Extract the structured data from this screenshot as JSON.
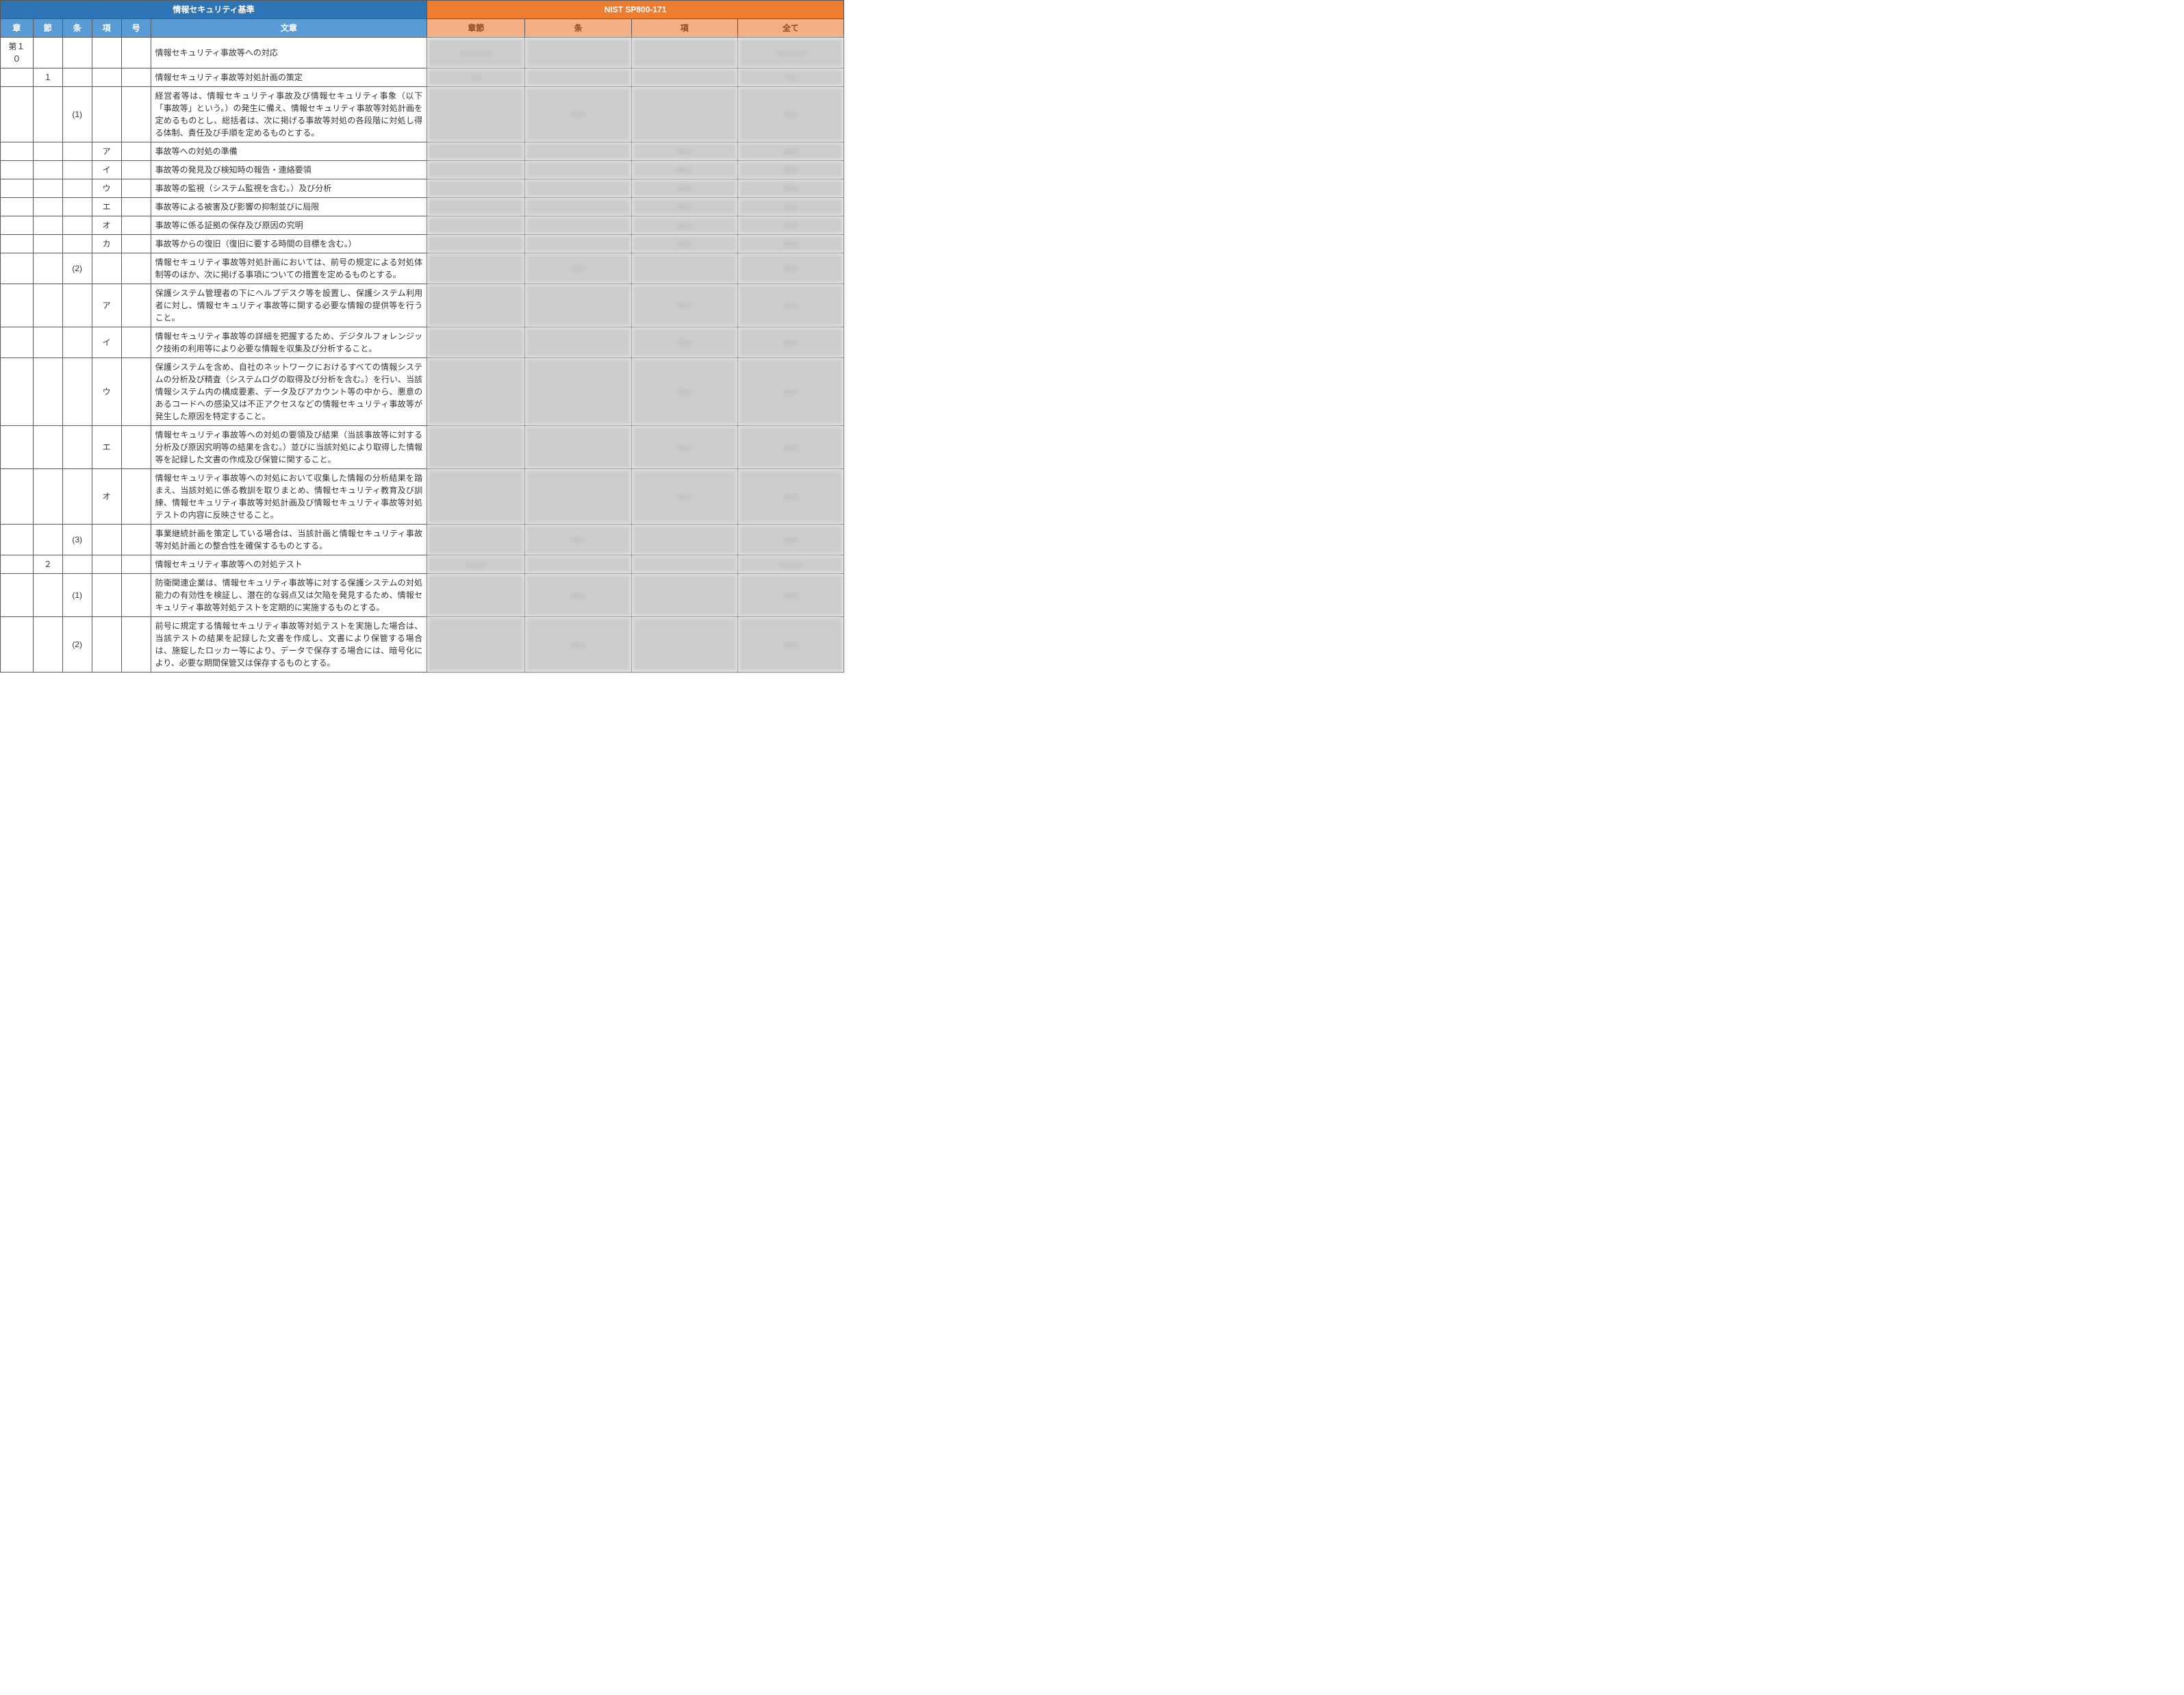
{
  "headers": {
    "left_super": "情報セキュリティ基準",
    "right_super": "NIST SP800-171",
    "left_cols": {
      "sho": "章",
      "setsu": "節",
      "jo": "条",
      "kou": "項",
      "gou": "号",
      "bunsho": "文章"
    },
    "right_cols": {
      "shosetsu": "章節",
      "jo": "条",
      "kou": "項",
      "subete": "全て"
    }
  },
  "rows": [
    {
      "sho": "第１０",
      "setsu": "",
      "jo": "",
      "kou": "",
      "gou": "",
      "bunsho": "情報セキュリティ事故等への対応",
      "n1": "x.x  x.x  x.x",
      "n2": "",
      "n3": "",
      "n4": "x.x  x.x  x.x"
    },
    {
      "sho": "",
      "setsu": "１",
      "jo": "",
      "kou": "",
      "gou": "",
      "bunsho": "情報セキュリティ事故等対処計画の策定",
      "n1": "x.x",
      "n2": "",
      "n3": "",
      "n4": "x.x"
    },
    {
      "sho": "",
      "setsu": "",
      "jo": "(1)",
      "kou": "",
      "gou": "",
      "bunsho": "経営者等は、情報セキュリティ事故及び情報セキュリティ事象（以下「事故等」という。）の発生に備え、情報セキュリティ事故等対処計画を定めるものとし、総括者は、次に掲げる事故等対処の各段階に対処し得る体制、責任及び手順を定めるものとする。",
      "n1": "",
      "n2": "xx.x",
      "n3": "",
      "n4": "xx.x"
    },
    {
      "sho": "",
      "setsu": "",
      "jo": "",
      "kou": "ア",
      "gou": "",
      "bunsho": "事故等への対処の準備",
      "n1": "",
      "n2": "",
      "n3": "xx.x",
      "n4": "xx.x"
    },
    {
      "sho": "",
      "setsu": "",
      "jo": "",
      "kou": "イ",
      "gou": "",
      "bunsho": "事故等の発見及び検知時の報告・連絡要領",
      "n1": "",
      "n2": "",
      "n3": "xx.x",
      "n4": "xx.x"
    },
    {
      "sho": "",
      "setsu": "",
      "jo": "",
      "kou": "ウ",
      "gou": "",
      "bunsho": "事故等の監視（システム監視を含む。）及び分析",
      "n1": "",
      "n2": "",
      "n3": "xx.x",
      "n4": "xx.x"
    },
    {
      "sho": "",
      "setsu": "",
      "jo": "",
      "kou": "エ",
      "gou": "",
      "bunsho": "事故等による被害及び影響の抑制並びに局限",
      "n1": "",
      "n2": "",
      "n3": "xx.x",
      "n4": "xx.x"
    },
    {
      "sho": "",
      "setsu": "",
      "jo": "",
      "kou": "オ",
      "gou": "",
      "bunsho": "事故等に係る証拠の保存及び原因の究明",
      "n1": "",
      "n2": "",
      "n3": "xx.x",
      "n4": "xx.x"
    },
    {
      "sho": "",
      "setsu": "",
      "jo": "",
      "kou": "カ",
      "gou": "",
      "bunsho": "事故等からの復旧（復旧に要する時間の目標を含む。）",
      "n1": "",
      "n2": "",
      "n3": "xx.x",
      "n4": "xx.x"
    },
    {
      "sho": "",
      "setsu": "",
      "jo": "(2)",
      "kou": "",
      "gou": "",
      "bunsho": "情報セキュリティ事故等対処計画においては、前号の規定による対処体制等のほか、次に掲げる事項についての措置を定めるものとする。",
      "n1": "",
      "n2": "xx.x",
      "n3": "",
      "n4": "xx.x"
    },
    {
      "sho": "",
      "setsu": "",
      "jo": "",
      "kou": "ア",
      "gou": "",
      "bunsho": "保護システム管理者の下にヘルプデスク等を設置し、保護システム利用者に対し、情報セキュリティ事故等に関する必要な情報の提供等を行うこと。",
      "n1": "",
      "n2": "",
      "n3": "xx.x",
      "n4": "xx.x"
    },
    {
      "sho": "",
      "setsu": "",
      "jo": "",
      "kou": "イ",
      "gou": "",
      "bunsho": "情報セキュリティ事故等の詳細を把握するため、デジタルフォレンジック技術の利用等により必要な情報を収集及び分析すること。",
      "n1": "",
      "n2": "",
      "n3": "xx.x",
      "n4": "xx.x"
    },
    {
      "sho": "",
      "setsu": "",
      "jo": "",
      "kou": "ウ",
      "gou": "",
      "bunsho": "保護システムを含め、自社のネットワークにおけるすべての情報システムの分析及び精査（システムログの取得及び分析を含む。）を行い、当該情報システム内の構成要素、データ及びアカウント等の中から、悪意のあるコードへの感染又は不正アクセスなどの情報セキュリティ事故等が発生した原因を特定すること。",
      "n1": "",
      "n2": "",
      "n3": "xx.x",
      "n4": "xx.x"
    },
    {
      "sho": "",
      "setsu": "",
      "jo": "",
      "kou": "エ",
      "gou": "",
      "bunsho": "情報セキュリティ事故等への対処の要領及び結果（当該事故等に対する分析及び原因究明等の結果を含む。）並びに当該対処により取得した情報等を記録した文書の作成及び保管に関すること。",
      "n1": "",
      "n2": "",
      "n3": "xx.x",
      "n4": "xx.x"
    },
    {
      "sho": "",
      "setsu": "",
      "jo": "",
      "kou": "オ",
      "gou": "",
      "bunsho": "情報セキュリティ事故等への対処において収集した情報の分析結果を踏まえ、当該対処に係る教訓を取りまとめ、情報セキュリティ教育及び訓練、情報セキュリティ事故等対処計画及び情報セキュリティ事故等対処テストの内容に反映させること。",
      "n1": "",
      "n2": "",
      "n3": "xx.x",
      "n4": "xx.x"
    },
    {
      "sho": "",
      "setsu": "",
      "jo": "(3)",
      "kou": "",
      "gou": "",
      "bunsho": "事業継続計画を策定している場合は、当該計画と情報セキュリティ事故等対処計画との整合性を確保するものとする。",
      "n1": "",
      "n2": "xx.x",
      "n3": "",
      "n4": "xx.x"
    },
    {
      "sho": "",
      "setsu": "２",
      "jo": "",
      "kou": "",
      "gou": "",
      "bunsho": "情報セキュリティ事故等への対処テスト",
      "n1": "x.x  x.x",
      "n2": "",
      "n3": "",
      "n4": "x.x  x.x"
    },
    {
      "sho": "",
      "setsu": "",
      "jo": "(1)",
      "kou": "",
      "gou": "",
      "bunsho": "防衛関連企業は、情報セキュリティ事故等に対する保護システムの対処能力の有効性を検証し、潜在的な弱点又は欠陥を発見するため、情報セキュリティ事故等対処テストを定期的に実施するものとする。",
      "n1": "",
      "n2": "xx.x",
      "n3": "",
      "n4": "xx.x"
    },
    {
      "sho": "",
      "setsu": "",
      "jo": "(2)",
      "kou": "",
      "gou": "",
      "bunsho": "前号に規定する情報セキュリティ事故等対処テストを実施した場合は、当該テストの結果を記録した文書を作成し、文書により保管する場合は、施錠したロッカー等により、データで保存する場合には、暗号化により、必要な期間保管又は保存するものとする。",
      "n1": "",
      "n2": "xx.x",
      "n3": "",
      "n4": "xx.x"
    }
  ]
}
